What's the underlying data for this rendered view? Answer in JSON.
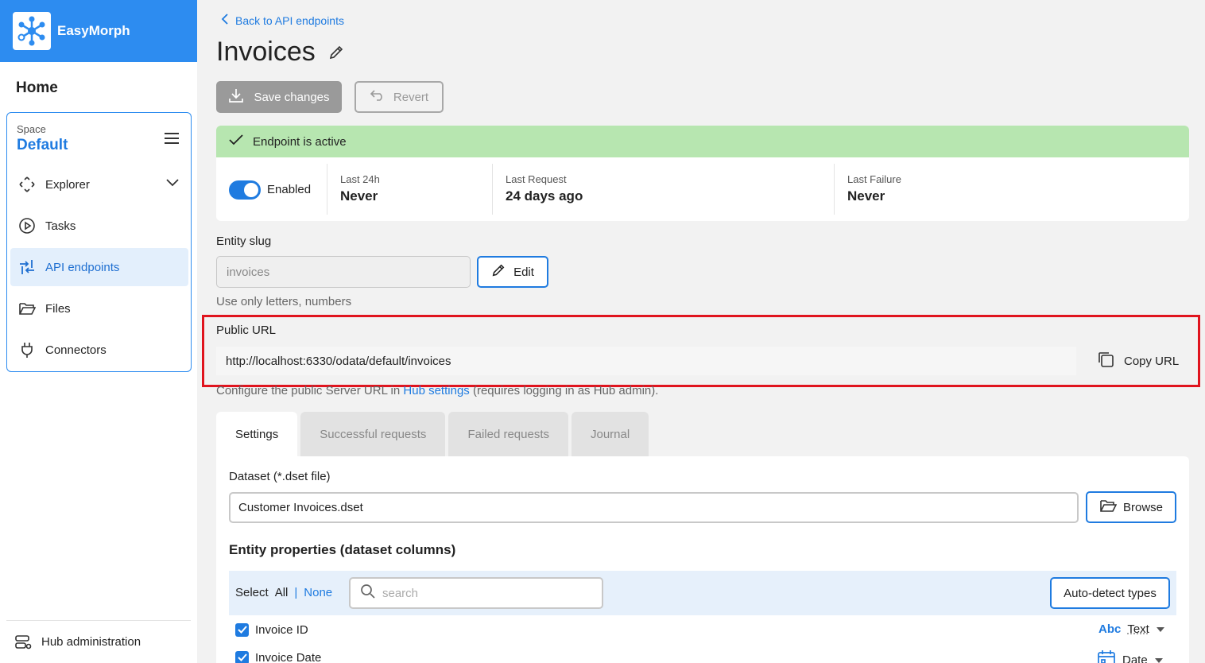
{
  "brand": {
    "name": "EasyMorph"
  },
  "sidebar": {
    "home_label": "Home",
    "space_label": "Space",
    "space_name": "Default",
    "items": [
      {
        "label": "Explorer",
        "icon": "explorer-icon"
      },
      {
        "label": "Tasks",
        "icon": "play-circle-icon"
      },
      {
        "label": "API endpoints",
        "icon": "api-icon",
        "active": true
      },
      {
        "label": "Files",
        "icon": "folder-icon"
      },
      {
        "label": "Connectors",
        "icon": "plug-icon"
      }
    ],
    "bottom_label": "Hub administration"
  },
  "header": {
    "back_label": "Back to API endpoints",
    "title": "Invoices",
    "save_label": "Save changes",
    "revert_label": "Revert"
  },
  "status": {
    "banner": "Endpoint is active",
    "toggle_label": "Enabled",
    "stats": [
      {
        "label": "Last 24h",
        "value": "Never"
      },
      {
        "label": "Last Request",
        "value": "24 days ago"
      },
      {
        "label": "Last Failure",
        "value": "Never"
      }
    ]
  },
  "slug": {
    "label": "Entity slug",
    "value": "invoices",
    "edit_label": "Edit",
    "hint": "Use only letters, numbers"
  },
  "public_url": {
    "label": "Public URL",
    "value": "http://localhost:6330/odata/default/invoices",
    "copy_label": "Copy URL",
    "hint_before": "Configure the public Server URL in ",
    "hint_link": "Hub settings",
    "hint_after": " (requires logging in as Hub admin)."
  },
  "tabs": [
    "Settings",
    "Successful requests",
    "Failed requests",
    "Journal"
  ],
  "settings": {
    "dataset_label": "Dataset (*.dset file)",
    "dataset_value": "Customer Invoices.dset",
    "browse_label": "Browse",
    "section_title": "Entity properties (dataset columns)",
    "select_label": "Select",
    "select_all": "All",
    "select_sep": "|",
    "select_none": "None",
    "search_placeholder": "search",
    "autodetect_label": "Auto-detect types",
    "columns": [
      {
        "name": "Invoice ID",
        "type_icon": "Abc",
        "type": "Text"
      },
      {
        "name": "Invoice Date",
        "type_icon": "calendar-icon",
        "type": "Date"
      }
    ]
  },
  "colors": {
    "accent": "#1f7be0",
    "brand": "#2d8cf0",
    "success_banner": "#b7e6b0",
    "highlight": "#e0141e"
  }
}
